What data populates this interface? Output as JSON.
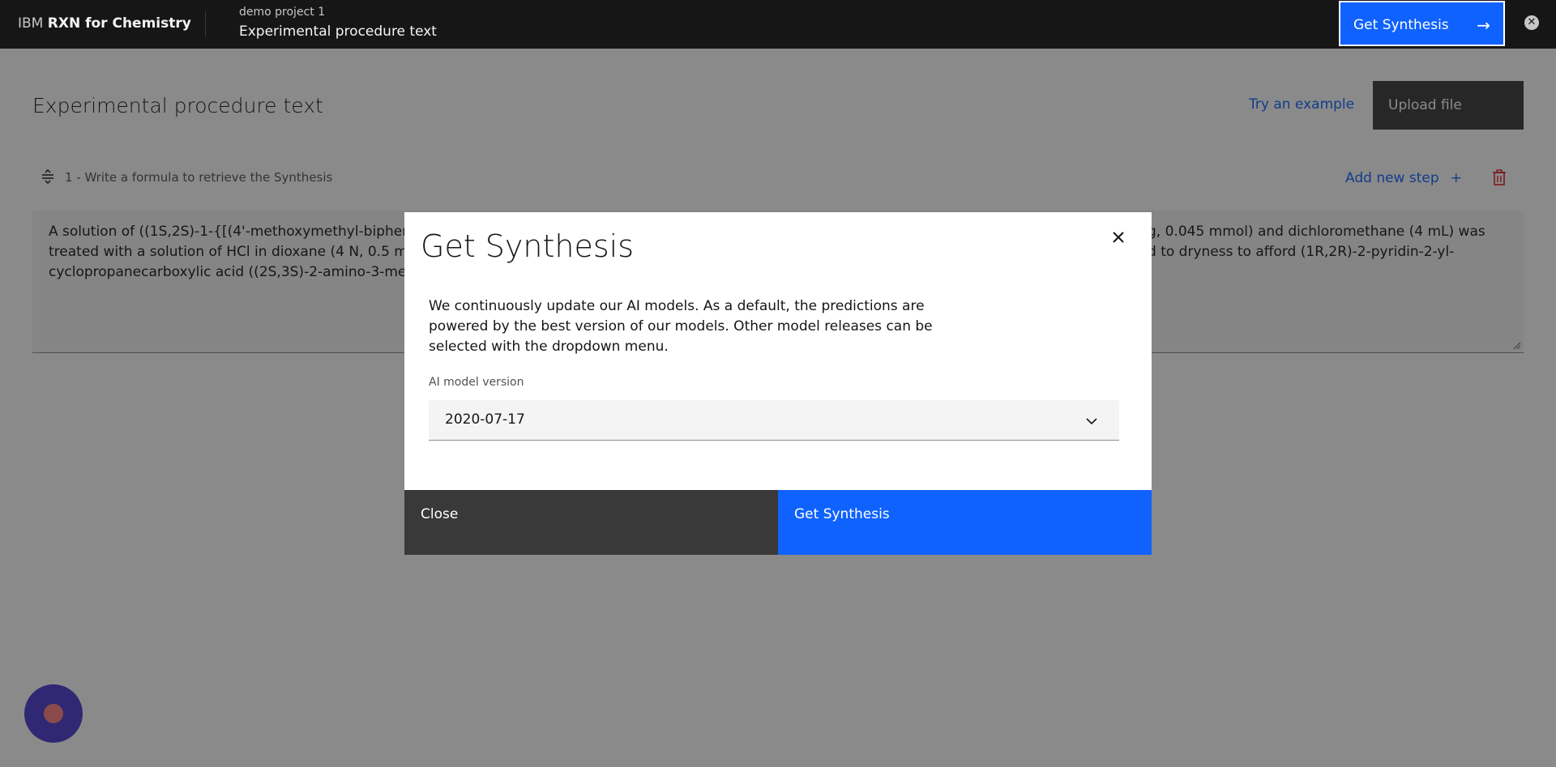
{
  "header": {
    "brand_prefix": "IBM",
    "brand_name": "RXN for Chemistry",
    "project": "demo project 1",
    "page": "Experimental procedure text",
    "get_synthesis_label": "Get Synthesis",
    "arrow_icon": "arrow-right-icon",
    "close_icon": "close-circle-icon"
  },
  "main": {
    "title": "Experimental procedure text",
    "try_example": "Try an example",
    "upload_file": "Upload file",
    "step_label": "1 - Write a formula to retrieve the Synthesis",
    "add_step": "Add new step",
    "add_icon": "+",
    "procedure_line1": "A solution of ((1S,2S)-1-{[(4'-methoxymethyl-biphenyl-",
    "procedure_line1_end": "g, 0.045 mmol) and dichloromethane (4 mL) was",
    "procedure_line2": "treated with a solution of HCl in dioxane (4 N, 0.5 mL) a",
    "procedure_line2_end": "d to dryness to afford (1R,2R)-2-pyridin-2-yl-",
    "procedure_line3": "cyclopropanecarboxylic acid ((2S,3S)-2-amino-3-meth"
  },
  "modal": {
    "title": "Get Synthesis",
    "description": "We continuously update our AI models. As a default, the predictions are powered by the best version of our models. Other model releases can be selected with the dropdown menu.",
    "field_label": "AI model version",
    "selected_version": "2020-07-17",
    "close_label": "Close",
    "primary_label": "Get Synthesis"
  },
  "colors": {
    "primary": "#0f62fe",
    "header_bg": "#161616",
    "danger": "#da1e28",
    "chat_bg": "#4a3ad0"
  }
}
